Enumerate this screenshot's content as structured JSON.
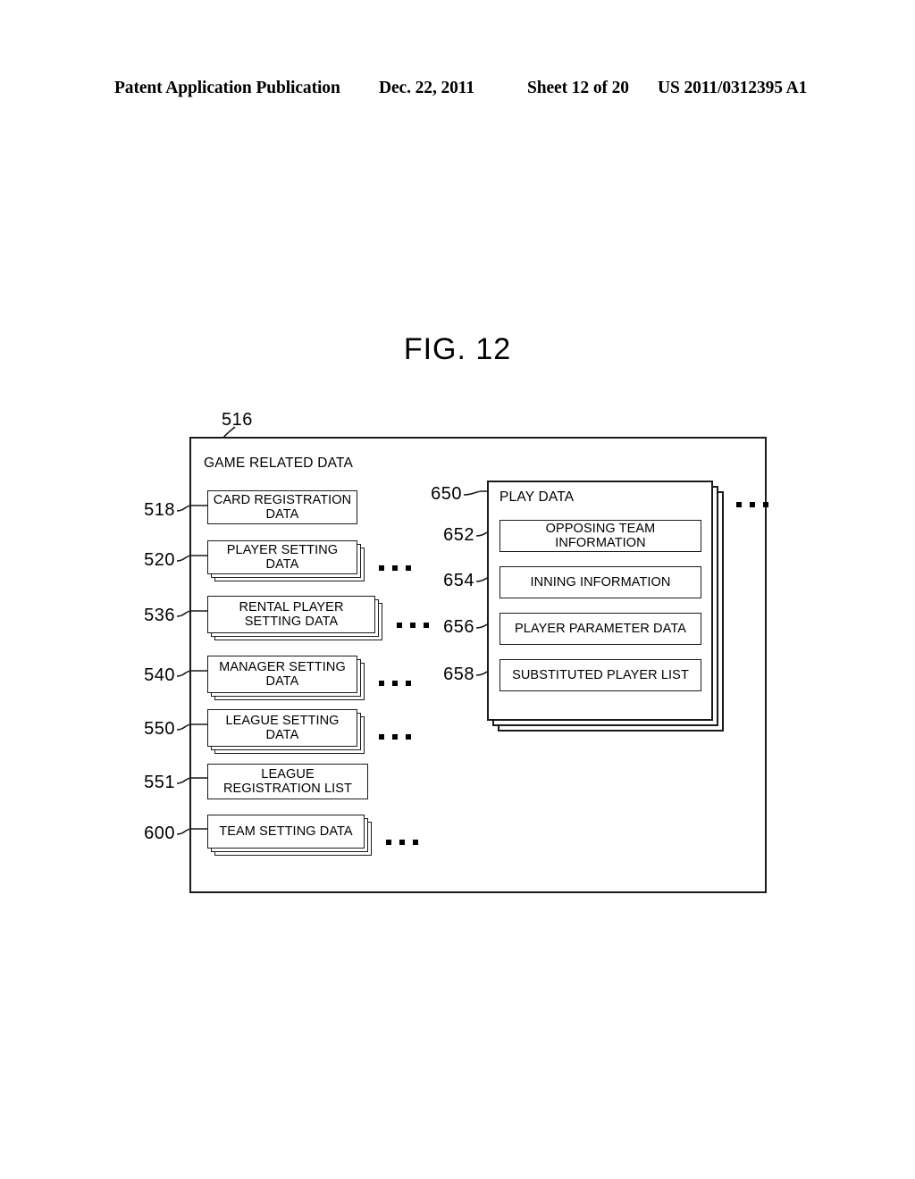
{
  "page_header": {
    "publication": "Patent Application Publication",
    "date": "Dec. 22, 2011",
    "sheet": "Sheet 12 of 20",
    "document_number": "US 2011/0312395 A1"
  },
  "figure": {
    "title": "FIG. 12"
  },
  "diagram": {
    "outer": {
      "ref": "516",
      "title": "GAME RELATED DATA"
    },
    "left_column": [
      {
        "ref": "518",
        "label": "CARD REGISTRATION DATA",
        "stacked": false,
        "ellipsis": false
      },
      {
        "ref": "520",
        "label": "PLAYER SETTING DATA",
        "stacked": true,
        "ellipsis": true
      },
      {
        "ref": "536",
        "label": "RENTAL PLAYER SETTING DATA",
        "stacked": true,
        "ellipsis": true
      },
      {
        "ref": "540",
        "label": "MANAGER SETTING DATA",
        "stacked": true,
        "ellipsis": true
      },
      {
        "ref": "550",
        "label": "LEAGUE SETTING DATA",
        "stacked": true,
        "ellipsis": true
      },
      {
        "ref": "551",
        "label": "LEAGUE REGISTRATION LIST",
        "stacked": false,
        "ellipsis": false
      },
      {
        "ref": "600",
        "label": "TEAM SETTING DATA",
        "stacked": true,
        "ellipsis": true
      }
    ],
    "play_data": {
      "ref": "650",
      "title": "PLAY DATA",
      "stacked": true,
      "ellipsis": true,
      "items": [
        {
          "ref": "652",
          "label": "OPPOSING TEAM INFORMATION"
        },
        {
          "ref": "654",
          "label": "INNING INFORMATION"
        },
        {
          "ref": "656",
          "label": "PLAYER PARAMETER DATA"
        },
        {
          "ref": "658",
          "label": "SUBSTITUTED PLAYER LIST"
        }
      ]
    }
  },
  "colors": {
    "ink": "#1a1a1a",
    "paper": "#ffffff"
  }
}
